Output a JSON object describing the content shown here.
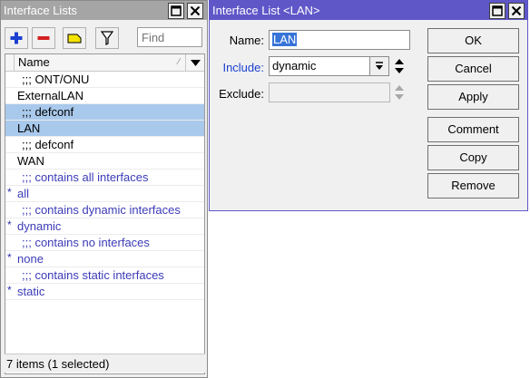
{
  "lists_window": {
    "title": "Interface Lists",
    "find_placeholder": "Find",
    "column_header": "Name",
    "rows": [
      {
        "flag": "",
        "text": ";;; ONT/ONU",
        "kind": "comment-dark"
      },
      {
        "flag": "",
        "text": "ExternalLAN",
        "kind": "item"
      },
      {
        "flag": "",
        "text": ";;; defconf",
        "kind": "comment-selected"
      },
      {
        "flag": "",
        "text": "LAN",
        "kind": "item-selected"
      },
      {
        "flag": "",
        "text": ";;; defconf",
        "kind": "comment-dark"
      },
      {
        "flag": "",
        "text": "WAN",
        "kind": "item"
      },
      {
        "flag": "",
        "text": ";;; contains all interfaces",
        "kind": "comment"
      },
      {
        "flag": "*",
        "text": "all",
        "kind": "dyn"
      },
      {
        "flag": "",
        "text": ";;; contains dynamic interfaces",
        "kind": "comment"
      },
      {
        "flag": "*",
        "text": "dynamic",
        "kind": "dyn"
      },
      {
        "flag": "",
        "text": ";;; contains no interfaces",
        "kind": "comment"
      },
      {
        "flag": "*",
        "text": "none",
        "kind": "dyn"
      },
      {
        "flag": "",
        "text": ";;; contains static interfaces",
        "kind": "comment"
      },
      {
        "flag": "*",
        "text": "static",
        "kind": "dyn"
      }
    ],
    "status": "7 items (1 selected)"
  },
  "detail_window": {
    "title": "Interface List <LAN>",
    "name_label": "Name:",
    "name_value": "LAN",
    "include_label": "Include:",
    "include_value": "dynamic",
    "exclude_label": "Exclude:",
    "exclude_value": "",
    "buttons": {
      "ok": "OK",
      "cancel": "Cancel",
      "apply": "Apply",
      "comment": "Comment",
      "copy": "Copy",
      "remove": "Remove"
    }
  },
  "colors": {
    "active_title": "#5f57c8",
    "inactive_title": "#a5a5a5",
    "selection": "#a9c9ec",
    "dynamic_text": "#3b3bb8"
  },
  "icons": {
    "add": "plus-icon",
    "remove": "minus-icon",
    "comment": "note-icon",
    "filter": "filter-icon"
  }
}
